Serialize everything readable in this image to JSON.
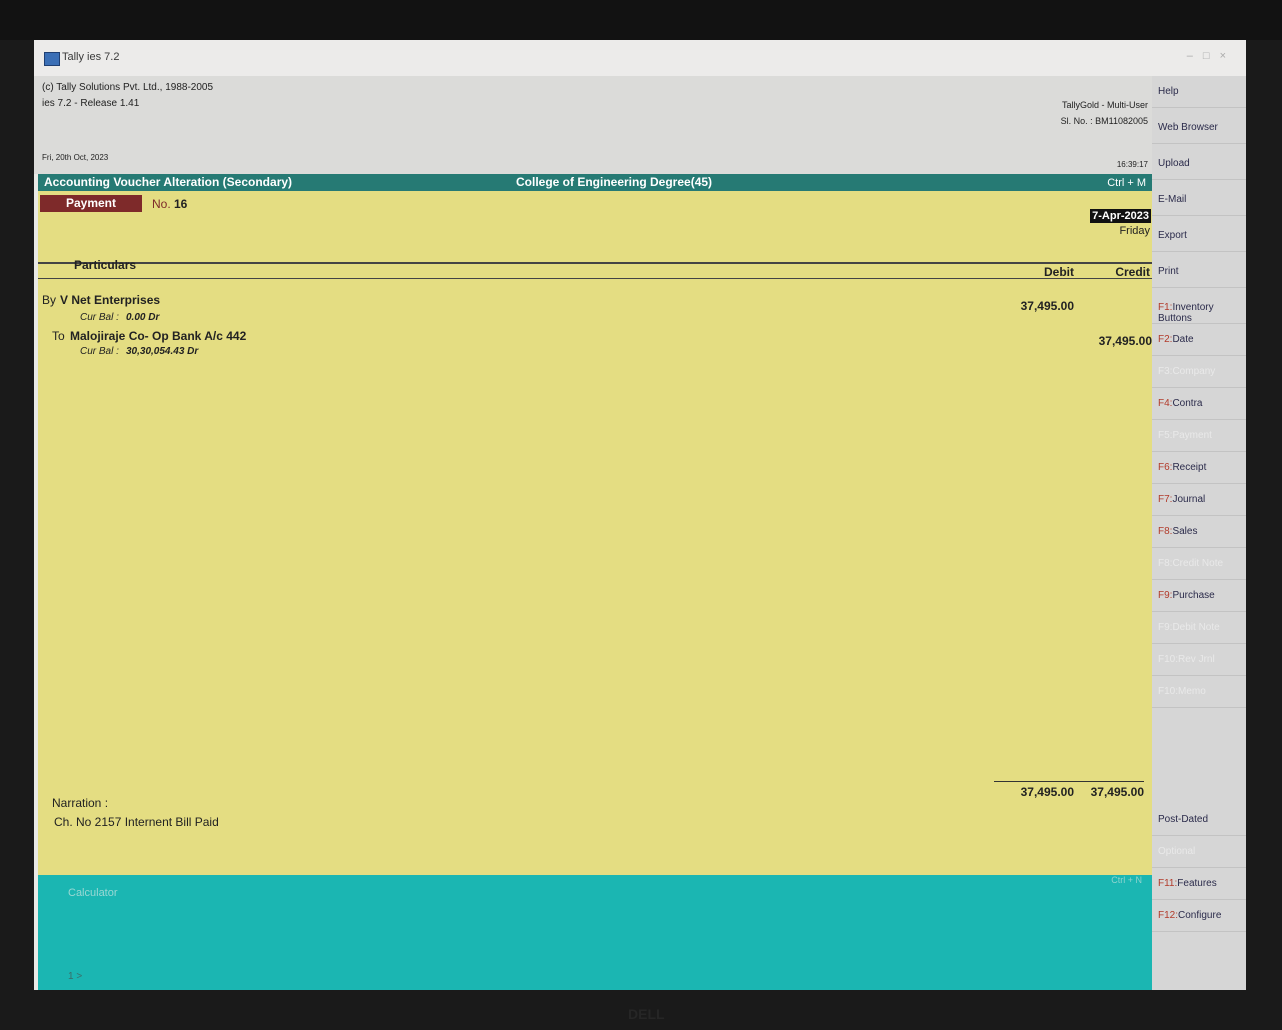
{
  "window": {
    "title": "Tally ies 7.2",
    "icon": "tally-app-icon",
    "controls": [
      "–",
      "□",
      "×"
    ]
  },
  "header": {
    "copyright": "(c) Tally Solutions Pvt. Ltd., 1988-2005",
    "release": "ies 7.2 - Release 1.41",
    "current_date": "Fri, 20th Oct, 2023",
    "license_edition": "TallyGold - Multi-User",
    "serial_no": "Sl. No. : BM11082005",
    "time": "16:39:17"
  },
  "voucher_bar": {
    "title": "Accounting Voucher Alteration (Secondary)",
    "company": "College of Engineering Degree(45)",
    "shortcut": "Ctrl + M"
  },
  "voucher": {
    "type": "Payment",
    "no_label": "No.",
    "number": "16",
    "date": "7-Apr-2023",
    "day": "Friday"
  },
  "columns": {
    "particulars": "Particulars",
    "debit": "Debit",
    "credit": "Credit"
  },
  "entries": [
    {
      "prefix": "By",
      "ledger": "V Net Enterprises",
      "curbal_label": "Cur Bal :",
      "curbal": "0.00 Dr",
      "debit": "37,495.00",
      "credit": ""
    },
    {
      "prefix": "To",
      "ledger": "Malojiraje Co- Op Bank  A/c 442",
      "curbal_label": "Cur Bal :",
      "curbal": "30,30,054.43 Dr",
      "debit": "",
      "credit": "37,495.00"
    }
  ],
  "totals": {
    "debit": "37,495.00",
    "credit": "37,495.00"
  },
  "narration": {
    "label": "Narration :",
    "text": "Ch. No  2157 Internent Bill Paid"
  },
  "calculator": {
    "label": "Calculator",
    "prompt": "1 >",
    "shortcut": "Ctrl + N"
  },
  "side_buttons": [
    {
      "key": "",
      "label": "Help"
    },
    {
      "key": "",
      "label": "Web Browser"
    },
    {
      "key": "",
      "label": "Upload"
    },
    {
      "key": "",
      "label": "E-Mail"
    },
    {
      "key": "",
      "label": "Export"
    },
    {
      "key": "",
      "label": "Print"
    },
    {
      "key": "F1:",
      "label": "Inventory Buttons"
    },
    {
      "key": "F2:",
      "label": "Date"
    },
    {
      "key": "F3:",
      "label": "Company"
    },
    {
      "key": "F4:",
      "label": "Contra"
    },
    {
      "key": "F5:",
      "label": "Payment"
    },
    {
      "key": "F6:",
      "label": "Receipt"
    },
    {
      "key": "F7:",
      "label": "Journal"
    },
    {
      "key": "F8:",
      "label": "Sales"
    },
    {
      "key": "F8:",
      "label": "Credit Note"
    },
    {
      "key": "F9:",
      "label": "Purchase"
    },
    {
      "key": "F9:",
      "label": "Debit Note"
    },
    {
      "key": "F10:",
      "label": "Rev Jrnl"
    },
    {
      "key": "F10:",
      "label": "Memo"
    },
    {
      "key": "",
      "label": "Post-Dated"
    },
    {
      "key": "",
      "label": "Optional"
    },
    {
      "key": "F11:",
      "label": "Features"
    },
    {
      "key": "F12:",
      "label": "Configure"
    }
  ],
  "monitor_logo": "DELL"
}
